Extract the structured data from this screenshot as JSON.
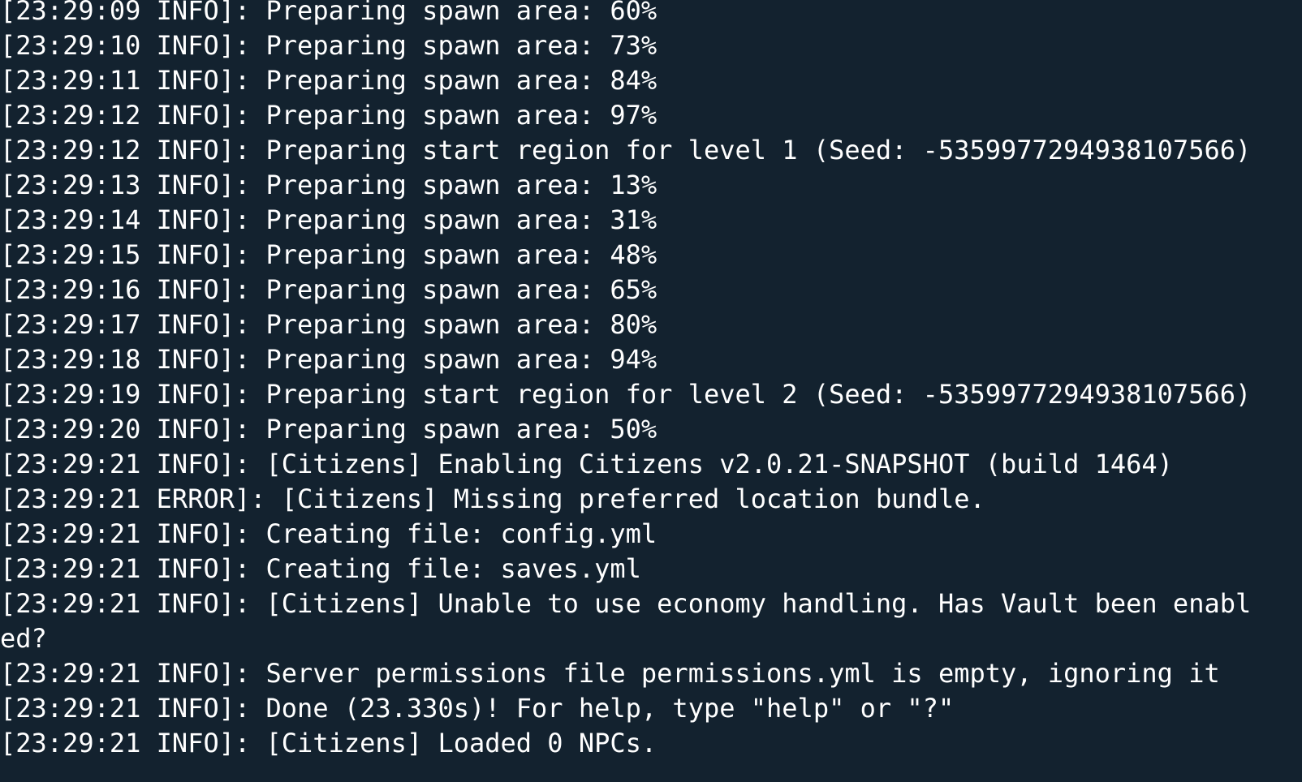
{
  "terminal": {
    "colors": {
      "background": "#13222f",
      "text": "#ffffff"
    },
    "lines": [
      "[23:29:09 INFO]: Preparing spawn area: 60%",
      "[23:29:10 INFO]: Preparing spawn area: 73%",
      "[23:29:11 INFO]: Preparing spawn area: 84%",
      "[23:29:12 INFO]: Preparing spawn area: 97%",
      "[23:29:12 INFO]: Preparing start region for level 1 (Seed: -5359977294938107566)",
      "[23:29:13 INFO]: Preparing spawn area: 13%",
      "[23:29:14 INFO]: Preparing spawn area: 31%",
      "[23:29:15 INFO]: Preparing spawn area: 48%",
      "[23:29:16 INFO]: Preparing spawn area: 65%",
      "[23:29:17 INFO]: Preparing spawn area: 80%",
      "[23:29:18 INFO]: Preparing spawn area: 94%",
      "[23:29:19 INFO]: Preparing start region for level 2 (Seed: -5359977294938107566)",
      "[23:29:20 INFO]: Preparing spawn area: 50%",
      "[23:29:21 INFO]: [Citizens] Enabling Citizens v2.0.21-SNAPSHOT (build 1464)",
      "[23:29:21 ERROR]: [Citizens] Missing preferred location bundle.",
      "[23:29:21 INFO]: Creating file: config.yml",
      "[23:29:21 INFO]: Creating file: saves.yml",
      "[23:29:21 INFO]: [Citizens] Unable to use economy handling. Has Vault been enabl",
      "ed?",
      "[23:29:21 INFO]: Server permissions file permissions.yml is empty, ignoring it",
      "[23:29:21 INFO]: Done (23.330s)! For help, type \"help\" or \"?\"",
      "[23:29:21 INFO]: [Citizens] Loaded 0 NPCs."
    ]
  }
}
